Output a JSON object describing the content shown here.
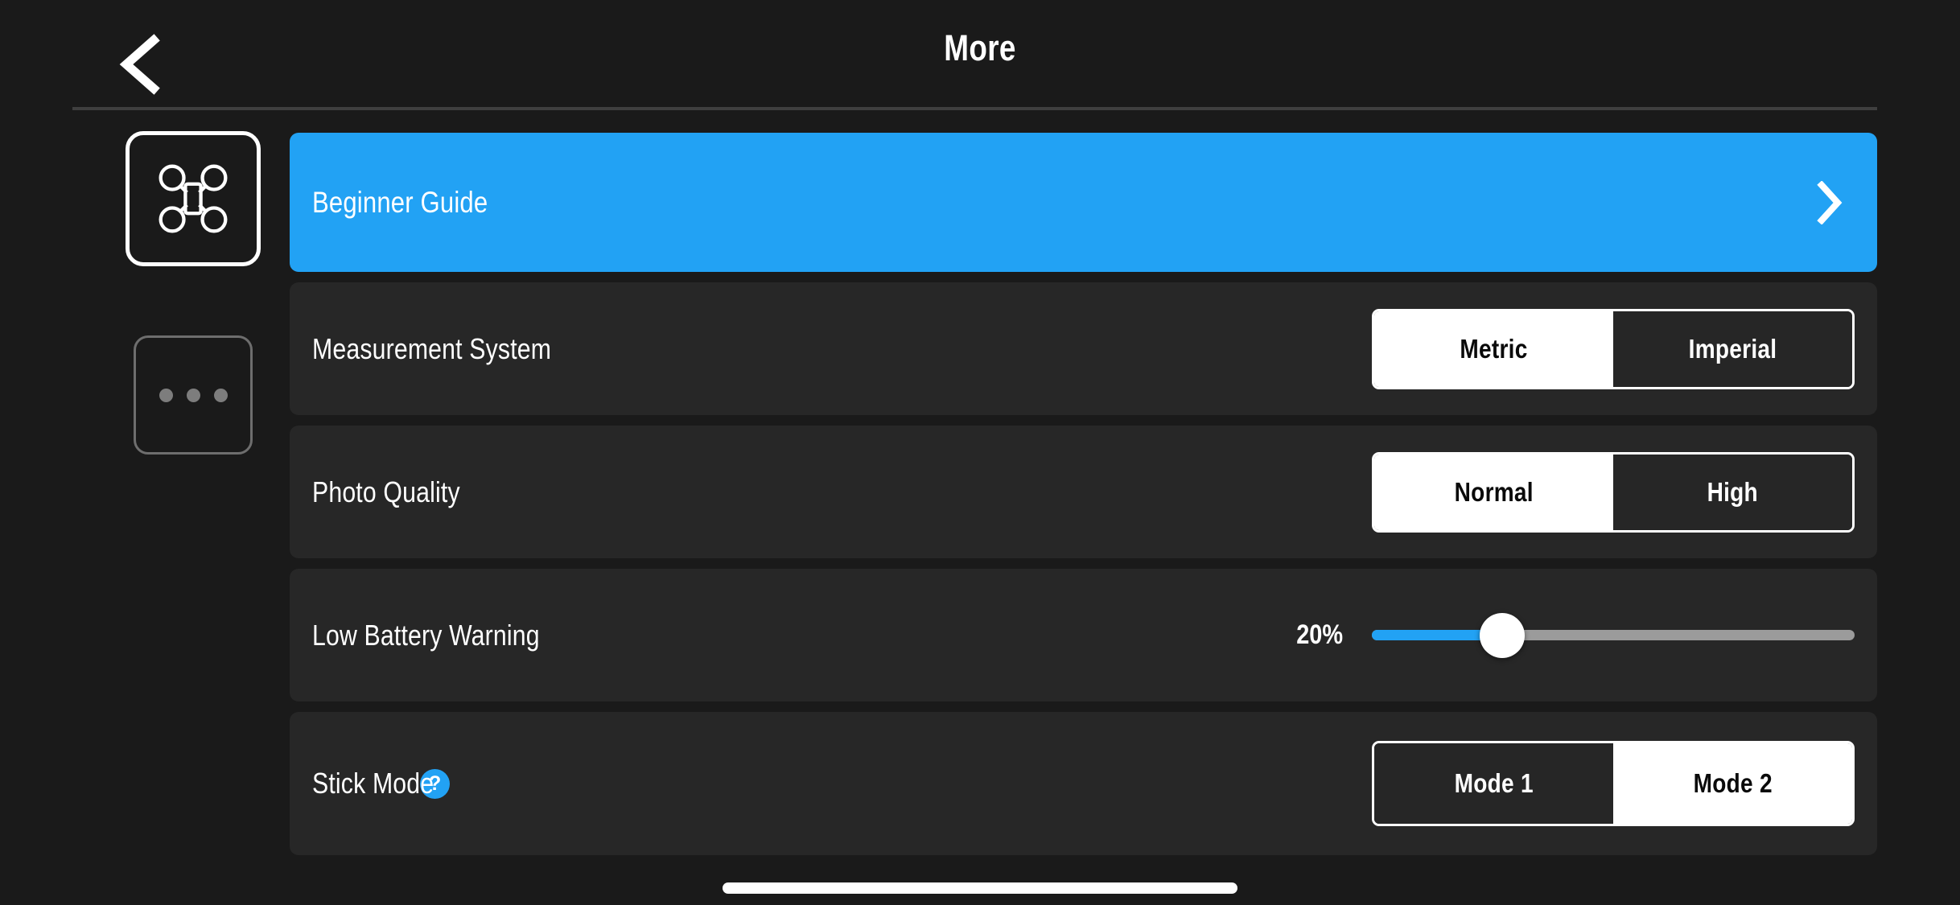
{
  "header": {
    "title": "More",
    "back_icon": "chevron-left-icon"
  },
  "sidebar": {
    "items": [
      {
        "id": "aircraft",
        "icon": "drone-icon",
        "selected": true
      },
      {
        "id": "more",
        "icon": "ellipsis-icon",
        "selected": false
      }
    ]
  },
  "settings": {
    "beginner_guide": {
      "label": "Beginner Guide",
      "chevron_icon": "chevron-right-icon",
      "accent_color": "#22a2f4"
    },
    "measurement_system": {
      "label": "Measurement System",
      "options": [
        "Metric",
        "Imperial"
      ],
      "selected": "Metric"
    },
    "photo_quality": {
      "label": "Photo Quality",
      "options": [
        "Normal",
        "High"
      ],
      "selected": "Normal"
    },
    "low_battery_warning": {
      "label": "Low Battery Warning",
      "value_text": "20%",
      "value": 20,
      "min": 0,
      "max": 100,
      "fill_percent": 27,
      "fill_color": "#22a2f4",
      "track_color": "#9b9b9b"
    },
    "stick_mode": {
      "label": "Stick Mode",
      "help_icon_text": "?",
      "help_icon": "question-mark-icon",
      "options": [
        "Mode 1",
        "Mode 2"
      ],
      "selected": "Mode 2"
    }
  },
  "system": {
    "home_indicator": "home-indicator-bar"
  },
  "colors": {
    "background": "#1a1a1a",
    "row_background": "#272727",
    "accent": "#22a2f4",
    "text_primary": "#ffffff",
    "divider": "#3f3f3f"
  }
}
